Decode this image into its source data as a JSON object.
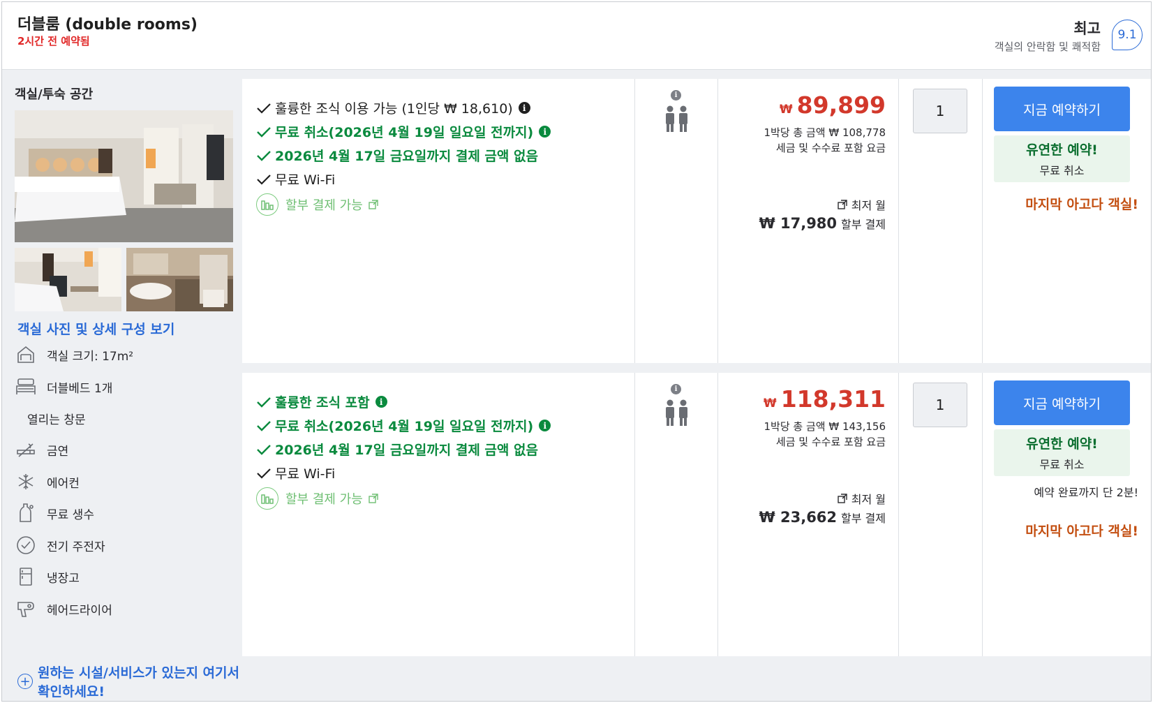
{
  "header": {
    "room_title": "더블룸 (double rooms)",
    "booked_ago": "2시간 전 예약됨",
    "review_word": "최고",
    "review_sub": "객실의 안락함 및 쾌적함",
    "score": "9.1"
  },
  "left": {
    "space_label": "객실/투숙 공간",
    "photos_link": "객실 사진 및 상세 구성 보기",
    "amenities": [
      {
        "label": "객실 크기: 17m²",
        "icon": "room-size-icon"
      },
      {
        "label": "더블베드 1개",
        "icon": "bed-icon"
      },
      {
        "label": "열리는 창문",
        "icon": ""
      },
      {
        "label": "금연",
        "icon": "no-smoking-icon"
      },
      {
        "label": "에어컨",
        "icon": "snowflake-icon"
      },
      {
        "label": "무료 생수",
        "icon": "water-bottle-icon"
      },
      {
        "label": "전기 주전자",
        "icon": "kettle-icon"
      },
      {
        "label": "냉장고",
        "icon": "fridge-icon"
      },
      {
        "label": "헤어드라이어",
        "icon": "hairdryer-icon"
      }
    ],
    "check_link": "원하는 시설/서비스가 있는지 여기서 확인하세요!"
  },
  "offers": [
    {
      "features": [
        {
          "text": "훌륭한 조식 이용 가능 (1인당 ₩ 18,610)",
          "style": "plain",
          "info": true
        },
        {
          "text": "무료 취소(2026년 4월 19일 일요일 전까지)",
          "style": "green",
          "info": true
        },
        {
          "text": "2026년 4월 17일 금요일까지 결제 금액 없음",
          "style": "green",
          "info": false
        },
        {
          "text": "무료 Wi-Fi",
          "style": "plain",
          "info": false
        }
      ],
      "installment": "할부 결제 가능",
      "price_currency": "₩",
      "price": "89,899",
      "total_line": "1박당 총 금액 ₩ 108,778",
      "tax_line": "세금 및 수수료 포함 요금",
      "monthly_label": "최저 월",
      "monthly_amount": "₩ 17,980",
      "monthly_suffix": "할부 결제",
      "quantity": "1",
      "book_label": "지금 예약하기",
      "flex_title": "유연한 예약!",
      "flex_sub": "무료 취소",
      "almost_text": "",
      "urgent_text": "마지막 아고다 객실!"
    },
    {
      "features": [
        {
          "text": "훌륭한 조식 포함",
          "style": "green",
          "info": true
        },
        {
          "text": "무료 취소(2026년 4월 19일 일요일 전까지)",
          "style": "green",
          "info": true
        },
        {
          "text": "2026년 4월 17일 금요일까지 결제 금액 없음",
          "style": "green",
          "info": false
        },
        {
          "text": "무료 Wi-Fi",
          "style": "plain",
          "info": false
        }
      ],
      "installment": "할부 결제 가능",
      "price_currency": "₩",
      "price": "118,311",
      "total_line": "1박당 총 금액 ₩ 143,156",
      "tax_line": "세금 및 수수료 포함 요금",
      "monthly_label": "최저 월",
      "monthly_amount": "₩ 23,662",
      "monthly_suffix": "할부 결제",
      "quantity": "1",
      "book_label": "지금 예약하기",
      "flex_title": "유연한 예약!",
      "flex_sub": "무료 취소",
      "almost_text": "예약 완료까지 단 2분!",
      "urgent_text": "마지막 아고다 객실!"
    }
  ],
  "colors": {
    "accent_blue": "#3c84ec",
    "link_blue": "#2a6ad6",
    "price_red": "#d2382b",
    "green": "#0a8a3e",
    "urgent_orange": "#c34e10"
  }
}
